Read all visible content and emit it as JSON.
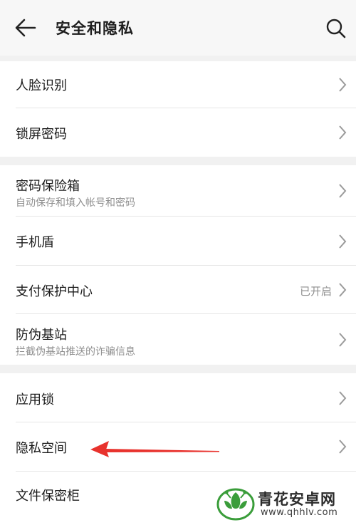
{
  "header": {
    "back_icon": "back-arrow-icon",
    "title": "安全和隐私",
    "search_icon": "search-icon"
  },
  "groups": [
    {
      "items": [
        {
          "label": "人脸识别"
        },
        {
          "label": "锁屏密码"
        }
      ]
    },
    {
      "items": [
        {
          "label": "密码保险箱",
          "subtitle": "自动保存和填入帐号和密码"
        },
        {
          "label": "手机盾"
        },
        {
          "label": "支付保护中心",
          "value": "已开启"
        },
        {
          "label": "防伪基站",
          "subtitle": "拦截伪基站推送的诈骗信息"
        }
      ]
    },
    {
      "items": [
        {
          "label": "应用锁"
        },
        {
          "label": "隐私空间"
        },
        {
          "label": "文件保密柜"
        }
      ]
    }
  ],
  "annotation": {
    "color": "#e8322d"
  },
  "watermark": {
    "name": "青花安卓网",
    "url": "www.qhhlv.com",
    "logo_color": "#3a9d3a"
  }
}
